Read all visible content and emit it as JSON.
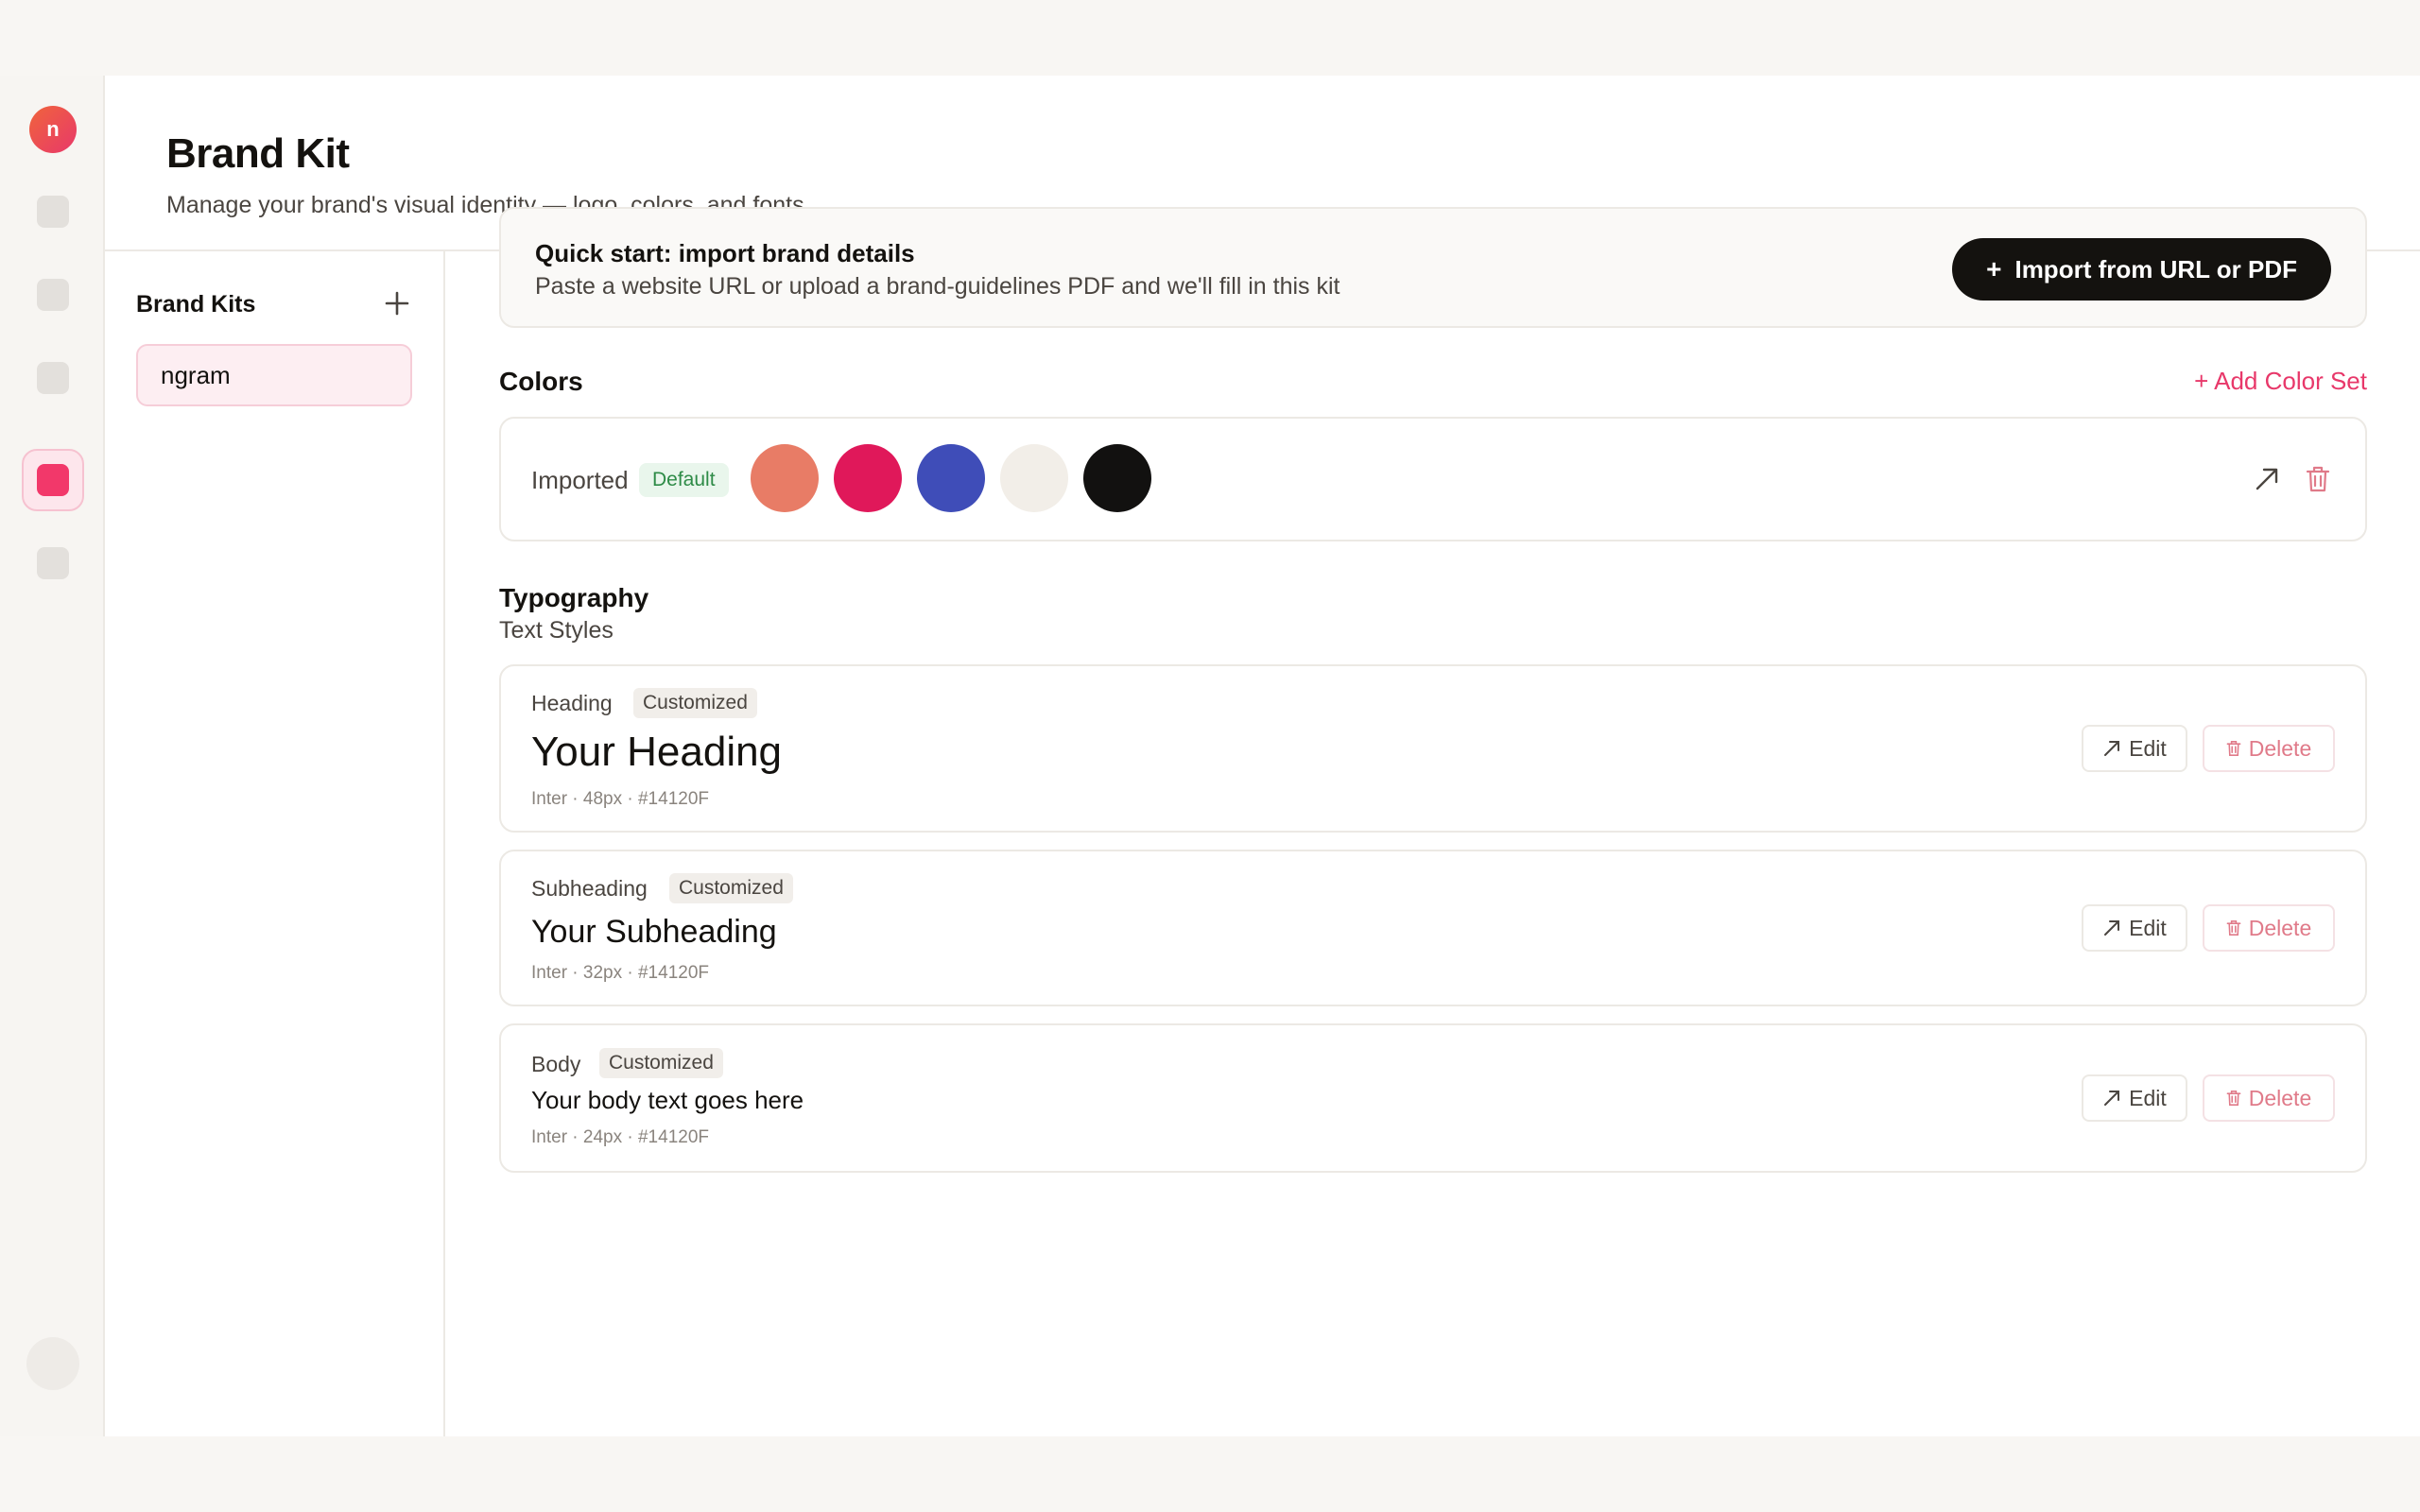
{
  "app": {
    "logo_letter": "n",
    "title": "Brand Kit",
    "subtitle": "Manage your brand's visual identity — logo, colors, and fonts"
  },
  "sidebar": {
    "title": "Brand Kits",
    "add_icon": "plus-icon",
    "kits": [
      {
        "label": "ngram"
      }
    ]
  },
  "quick_start": {
    "title": "Quick start: import brand details",
    "description": "Paste a website URL or upload a brand-guidelines PDF and we'll fill in this kit",
    "button_icon": "+",
    "button_label": "Import from URL or PDF"
  },
  "colors": {
    "title": "Colors",
    "add_label": "+ Add Color Set",
    "sets": [
      {
        "name": "Imported",
        "badge": "Default",
        "swatches": [
          "#E87C66",
          "#E0185A",
          "#3F4DB8",
          "#F2EEE8",
          "#121110"
        ]
      }
    ]
  },
  "typography": {
    "title": "Typography",
    "subtitle": "Text Styles",
    "edit_label": "Edit",
    "delete_label": "Delete",
    "styles": [
      {
        "label": "Heading",
        "badge": "Customized",
        "sample": "Your Heading",
        "meta": "Inter · 48px · #14120F"
      },
      {
        "label": "Subheading",
        "badge": "Customized",
        "sample": "Your Subheading",
        "meta": "Inter · 32px · #14120F"
      },
      {
        "label": "Body",
        "badge": "Customized",
        "sample": "Your body text goes here",
        "meta": "Inter · 24px · #14120F"
      }
    ]
  },
  "colors_theme": {
    "accent": "#E8386A",
    "text": "#14120F"
  }
}
